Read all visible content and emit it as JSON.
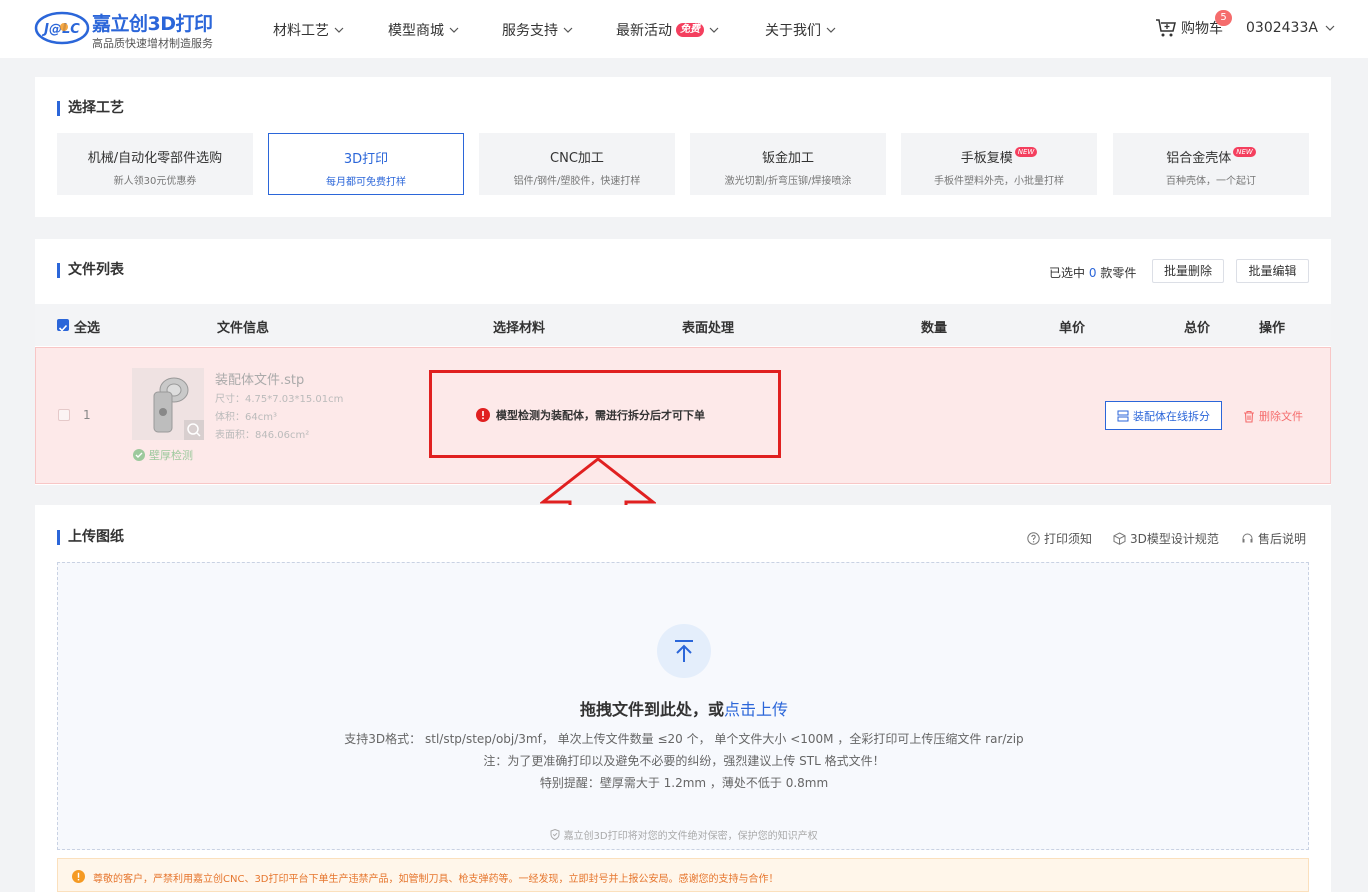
{
  "header": {
    "logo_text": "J@LC",
    "brand_title": "嘉立创3D打印",
    "brand_subtitle": "高品质快速增材制造服务",
    "nav": [
      {
        "label": "材料工艺"
      },
      {
        "label": "模型商城"
      },
      {
        "label": "服务支持"
      },
      {
        "label": "最新活动",
        "badge": "免费"
      },
      {
        "label": "关于我们"
      }
    ],
    "cart_label": "购物车",
    "cart_count": "5",
    "user_name": "0302433A"
  },
  "process": {
    "title": "选择工艺",
    "items": [
      {
        "title": "机械/自动化零部件选购",
        "subtitle": "新人领30元优惠券"
      },
      {
        "title": "3D打印",
        "subtitle": "每月都可免费打样",
        "active": true
      },
      {
        "title": "CNC加工",
        "subtitle": "铝件/钢件/塑胶件，快速打样"
      },
      {
        "title": "钣金加工",
        "subtitle": "激光切割/折弯压铆/焊接喷涂"
      },
      {
        "title": "手板复模",
        "subtitle": "手板件塑料外壳，小批量打样",
        "tag": "NEW"
      },
      {
        "title": "铝合金壳体",
        "subtitle": "百种壳体，一个起订",
        "tag": "NEW"
      }
    ]
  },
  "files": {
    "title": "文件列表",
    "selected_prefix": "已选中",
    "selected_count": "0",
    "selected_suffix": "款零件",
    "batch_delete": "批量删除",
    "batch_edit": "批量编辑",
    "columns": {
      "select_all": "全选",
      "info": "文件信息",
      "material": "选择材料",
      "surface": "表面处理",
      "qty": "数量",
      "unit_price": "单价",
      "total": "总价",
      "ops": "操作"
    },
    "row": {
      "index": "1",
      "name": "装配体文件.stp",
      "size": "尺寸：4.75*7.03*15.01cm",
      "volume": "体积：64cm³",
      "area": "表面积：846.06cm²",
      "wall_check": "壁厚检测",
      "warning": "模型检测为装配体，需进行拆分后才可下单",
      "split_button": "装配体在线拆分",
      "delete_button": "删除文件"
    }
  },
  "upload": {
    "title": "上传图纸",
    "links": [
      "打印须知",
      "3D模型设计规范",
      "售后说明"
    ],
    "drag_text": "拖拽文件到此处，或",
    "click_text": "点击上传",
    "formats": "支持3D格式： stl/stp/step/obj/3mf， 单次上传文件数量 ≤20 个， 单个文件大小 <100M ，全彩打印可上传压缩文件 rar/zip",
    "note": "注：为了更准确打印以及避免不必要的纠纷，强烈建议上传 STL 格式文件！",
    "reminder": "特别提醒：壁厚需大于 1.2mm ，薄处不低于 0.8mm",
    "privacy": "嘉立创3D打印将对您的文件绝对保密，保护您的知识产权"
  },
  "notice": {
    "text": "尊敬的客户，严禁利用嘉立创CNC、3D打印平台下单生产违禁产品，如管制刀具、枪支弹药等。一经发现，立即封号并上报公安局。感谢您的支持与合作！"
  },
  "colors": {
    "brand": "#2b66d9",
    "danger": "#e02020",
    "warn": "#f59a23"
  }
}
